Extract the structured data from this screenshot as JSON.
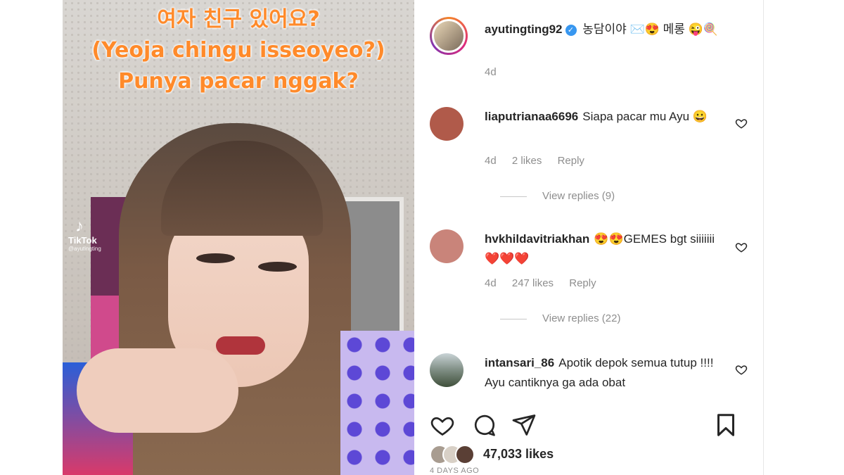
{
  "video": {
    "caption_line1": "여자 친구 있어요?",
    "caption_line2": "(Yeoja chingu isseoyeo?)",
    "caption_line3": "Punya pacar nggak?",
    "watermark_name": "TikTok",
    "watermark_handle": "@ayutingting"
  },
  "post": {
    "username": "ayutingting92",
    "caption": "농담이야 ✉️😍 메롱 😜🍭",
    "time": "4d"
  },
  "comments": [
    {
      "username": "liaputrianaa6696",
      "text": "Siapa pacar mu Ayu 😀",
      "time": "4d",
      "likes": "2 likes",
      "reply": "Reply",
      "view_replies": "View replies (9)",
      "avatar_color": "#b05a4a"
    },
    {
      "username": "hvkhildavitriakhan",
      "text": "😍😍GEMES bgt siiiiiii ❤️❤️❤️",
      "time": "4d",
      "likes": "247 likes",
      "reply": "Reply",
      "view_replies": "View replies (22)",
      "avatar_color": "#c9847a"
    },
    {
      "username": "intansari_86",
      "text": "Apotik depok semua tutup !!!! Ayu cantiknya ga ada obat",
      "avatar_color": "#5b6d58"
    }
  ],
  "footer": {
    "likes": "47,033 likes",
    "date": "4 DAYS AGO"
  }
}
